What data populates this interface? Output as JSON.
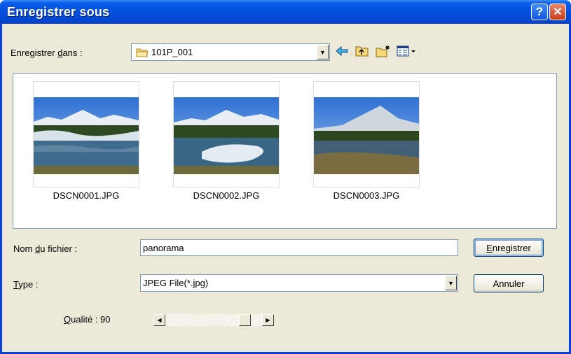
{
  "window": {
    "title": "Enregistrer sous",
    "help_symbol": "?",
    "close_symbol": "✕"
  },
  "save_in": {
    "label_prefix": "Enregistrer ",
    "label_accel": "d",
    "label_suffix": "ans :",
    "folder": "101P_001"
  },
  "toolbar": {
    "back_icon": "⇦",
    "up_icon": "up-folder-icon",
    "new_folder_icon": "new-folder-icon",
    "view_icon": "view-menu-icon"
  },
  "files": [
    {
      "name": "DSCN0001.JPG",
      "thumb": "mountain-lake-1"
    },
    {
      "name": "DSCN0002.JPG",
      "thumb": "mountain-lake-2"
    },
    {
      "name": "DSCN0003.JPG",
      "thumb": "mountain-lake-3"
    }
  ],
  "filename": {
    "label_prefix": "Nom ",
    "label_accel": "d",
    "label_suffix": "u fichier :",
    "value": "panorama"
  },
  "type": {
    "label_accel": "T",
    "label_suffix": "ype :",
    "value": "JPEG File(*.jpg)"
  },
  "quality": {
    "label_accel": "Q",
    "label_suffix": "ualité : 90",
    "value": 90
  },
  "buttons": {
    "save_accel": "E",
    "save_suffix": "nregistrer",
    "cancel": "Annuler"
  },
  "colors": {
    "titlebar": "#0452e0",
    "face": "#ece9d8",
    "border": "#7f9db9"
  }
}
